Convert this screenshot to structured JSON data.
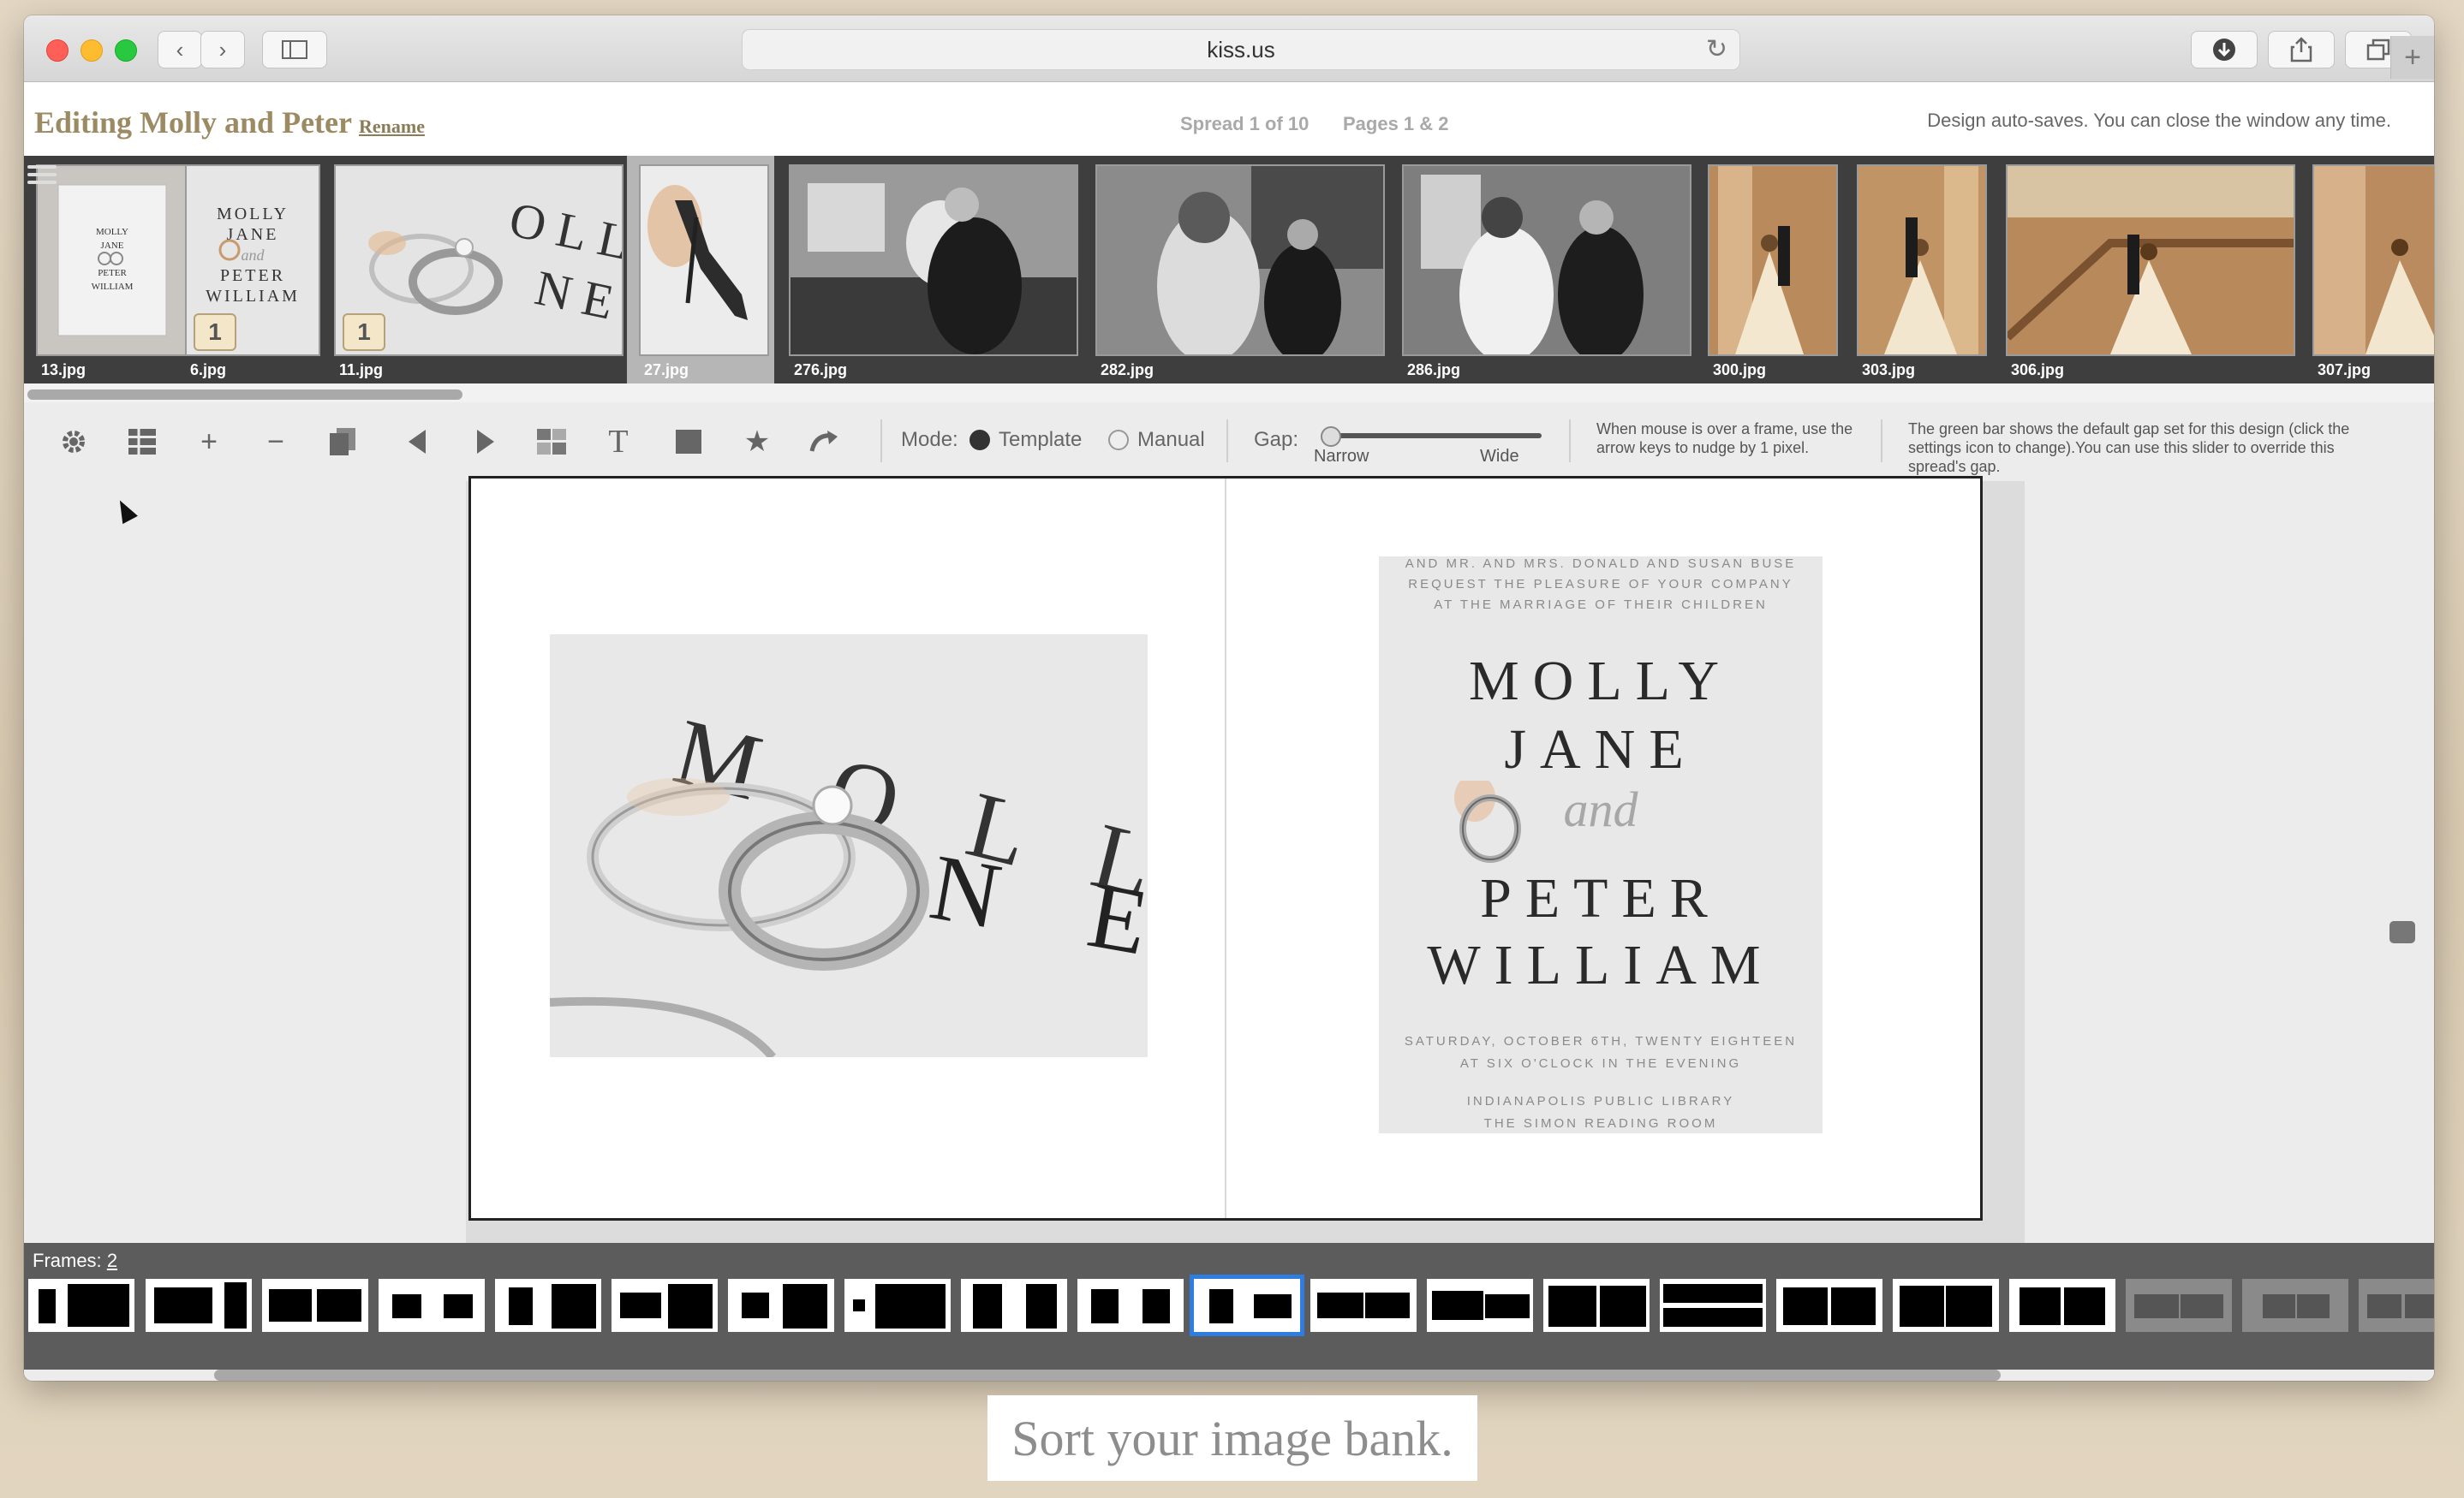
{
  "browser": {
    "url": "kiss.us"
  },
  "header": {
    "title": "Editing Molly and Peter",
    "rename_label": "Rename",
    "spread_info": "Spread 1 of 10",
    "pages_info": "Pages 1 & 2",
    "autosave_note": "Design auto-saves. You can close the window any time."
  },
  "image_bank": {
    "images": [
      {
        "name": "13.jpg",
        "badge": ""
      },
      {
        "name": "6.jpg",
        "badge": "1"
      },
      {
        "name": "11.jpg",
        "badge": "1"
      },
      {
        "name": "27.jpg",
        "badge": ""
      },
      {
        "name": "276.jpg",
        "badge": ""
      },
      {
        "name": "282.jpg",
        "badge": ""
      },
      {
        "name": "286.jpg",
        "badge": ""
      },
      {
        "name": "300.jpg",
        "badge": ""
      },
      {
        "name": "303.jpg",
        "badge": ""
      },
      {
        "name": "306.jpg",
        "badge": ""
      },
      {
        "name": "307.jpg",
        "badge": ""
      }
    ]
  },
  "toolbar": {
    "mode_label": "Mode:",
    "mode_template": "Template",
    "mode_manual": "Manual",
    "selected_mode": "Template",
    "gap_label": "Gap:",
    "gap_narrow": "Narrow",
    "gap_wide": "Wide",
    "nudge_hint": "When mouse is over a frame, use the arrow keys to nudge by 1 pixel.",
    "gap_hint": "The green bar shows the default gap set for this design (click the settings icon to change).You can use this slider to override this spread's gap."
  },
  "invitation": {
    "top_line1": "AND MR. AND MRS. DONALD AND SUSAN BUSE",
    "top_line2": "REQUEST THE PLEASURE OF YOUR COMPANY",
    "top_line3": "AT THE MARRIAGE OF THEIR CHILDREN",
    "name1": "MOLLY",
    "name2": "JANE",
    "and": "and",
    "name3": "PETER",
    "name4": "WILLIAM",
    "date_line1": "SATURDAY, OCTOBER 6TH, TWENTY EIGHTEEN",
    "date_line2": "AT SIX O'CLOCK IN THE EVENING",
    "venue_line1": "INDIANAPOLIS PUBLIC LIBRARY",
    "venue_line2": "THE SIMON READING ROOM"
  },
  "rings_photo_text": {
    "line1": "M O L L",
    "line2": "N E"
  },
  "frames": {
    "label": "Frames:",
    "count": "2",
    "selected_index": 10
  },
  "caption": "Sort your image bank.",
  "colors": {
    "title_gold": "#9c8a63",
    "selection_blue": "#2f7de1",
    "bank_bg": "#3e3e3e"
  }
}
